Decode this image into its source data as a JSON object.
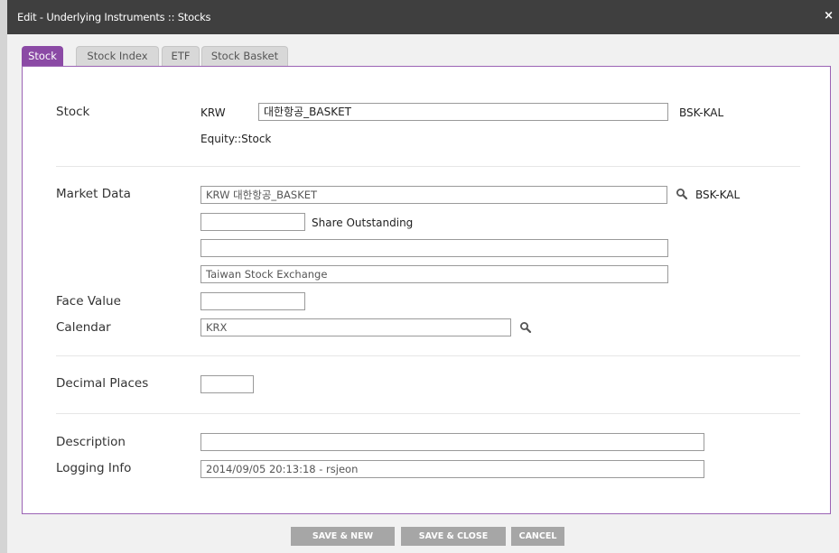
{
  "window": {
    "title": "Edit - Underlying Instruments :: Stocks",
    "close_glyph": "×"
  },
  "tabs": [
    {
      "label": "Stock",
      "active": true
    },
    {
      "label": "Stock Index",
      "active": false
    },
    {
      "label": "ETF",
      "active": false
    },
    {
      "label": "Stock Basket",
      "active": false
    }
  ],
  "stock": {
    "label": "Stock",
    "currency": "KRW",
    "name_value": "대한항공_BASKET",
    "code": "BSK-KAL",
    "type": "Equity::Stock"
  },
  "market_data": {
    "label": "Market Data",
    "source_value": "KRW 대한항공_BASKET",
    "code": "BSK-KAL",
    "share_outstanding_value": "",
    "share_outstanding_label": "Share Outstanding",
    "extra_value": "",
    "exchange_value": "Taiwan Stock Exchange"
  },
  "face_value": {
    "label": "Face Value",
    "value": ""
  },
  "calendar": {
    "label": "Calendar",
    "value": "KRX"
  },
  "decimal_places": {
    "label": "Decimal Places",
    "value": ""
  },
  "description": {
    "label": "Description",
    "value": ""
  },
  "logging_info": {
    "label": "Logging Info",
    "value": "2014/09/05 20:13:18 - rsjeon"
  },
  "buttons": {
    "save_new": "SAVE & NEW",
    "save_close": "SAVE & CLOSE",
    "cancel": "CANCEL"
  },
  "colors": {
    "accent": "#8b4aa5",
    "titlebar": "#3f3f3f",
    "button": "#a6a6a6"
  },
  "icons": {
    "search": "magnifier-icon",
    "close": "close-icon"
  }
}
